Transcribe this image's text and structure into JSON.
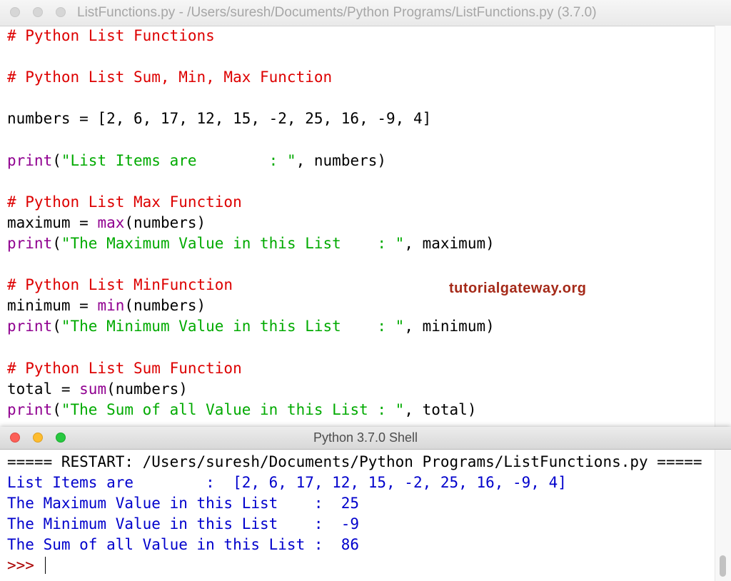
{
  "editor": {
    "title": "ListFunctions.py - /Users/suresh/Documents/Python Programs/ListFunctions.py (3.7.0)",
    "lines": [
      {
        "parts": [
          {
            "t": "# Python List Functions",
            "c": "comment"
          }
        ]
      },
      {
        "parts": []
      },
      {
        "parts": [
          {
            "t": "# Python List Sum, Min, Max Function",
            "c": "comment"
          }
        ]
      },
      {
        "parts": []
      },
      {
        "parts": [
          {
            "t": "numbers = [2, 6, 17, 12, 15, -2, 25, 16, -9, 4]",
            "c": "plain"
          }
        ]
      },
      {
        "parts": []
      },
      {
        "parts": [
          {
            "t": "print",
            "c": "builtin"
          },
          {
            "t": "(",
            "c": "plain"
          },
          {
            "t": "\"List Items are        : \"",
            "c": "string"
          },
          {
            "t": ", numbers)",
            "c": "plain"
          }
        ]
      },
      {
        "parts": []
      },
      {
        "parts": [
          {
            "t": "# Python List Max Function",
            "c": "comment"
          }
        ]
      },
      {
        "parts": [
          {
            "t": "maximum = ",
            "c": "plain"
          },
          {
            "t": "max",
            "c": "builtin"
          },
          {
            "t": "(numbers)",
            "c": "plain"
          }
        ]
      },
      {
        "parts": [
          {
            "t": "print",
            "c": "builtin"
          },
          {
            "t": "(",
            "c": "plain"
          },
          {
            "t": "\"The Maximum Value in this List    : \"",
            "c": "string"
          },
          {
            "t": ", maximum)",
            "c": "plain"
          }
        ]
      },
      {
        "parts": []
      },
      {
        "parts": [
          {
            "t": "# Python List MinFunction",
            "c": "comment"
          }
        ]
      },
      {
        "parts": [
          {
            "t": "minimum = ",
            "c": "plain"
          },
          {
            "t": "min",
            "c": "builtin"
          },
          {
            "t": "(numbers)",
            "c": "plain"
          }
        ]
      },
      {
        "parts": [
          {
            "t": "print",
            "c": "builtin"
          },
          {
            "t": "(",
            "c": "plain"
          },
          {
            "t": "\"The Minimum Value in this List    : \"",
            "c": "string"
          },
          {
            "t": ", minimum)",
            "c": "plain"
          }
        ]
      },
      {
        "parts": []
      },
      {
        "parts": [
          {
            "t": "# Python List Sum Function",
            "c": "comment"
          }
        ]
      },
      {
        "parts": [
          {
            "t": "total = ",
            "c": "plain"
          },
          {
            "t": "sum",
            "c": "builtin"
          },
          {
            "t": "(numbers)",
            "c": "plain"
          }
        ]
      },
      {
        "parts": [
          {
            "t": "print",
            "c": "builtin"
          },
          {
            "t": "(",
            "c": "plain"
          },
          {
            "t": "\"The Sum of all Value in this List : \"",
            "c": "string"
          },
          {
            "t": ", total)",
            "c": "plain"
          }
        ]
      }
    ]
  },
  "watermark": "tutorialgateway.org",
  "shell": {
    "title": "Python 3.7.0 Shell",
    "restart_line": "===== RESTART: /Users/suresh/Documents/Python Programs/ListFunctions.py =====",
    "output_lines": [
      "List Items are        :  [2, 6, 17, 12, 15, -2, 25, 16, -9, 4]",
      "The Maximum Value in this List    :  25",
      "The Minimum Value in this List    :  -9",
      "The Sum of all Value in this List :  86"
    ],
    "prompt": ">>> "
  },
  "colors": {
    "comment": "#dd0000",
    "builtin": "#900090",
    "string": "#00aa00",
    "shell_output": "#0000cc",
    "prompt": "#aa0000",
    "watermark": "#a52a19"
  }
}
